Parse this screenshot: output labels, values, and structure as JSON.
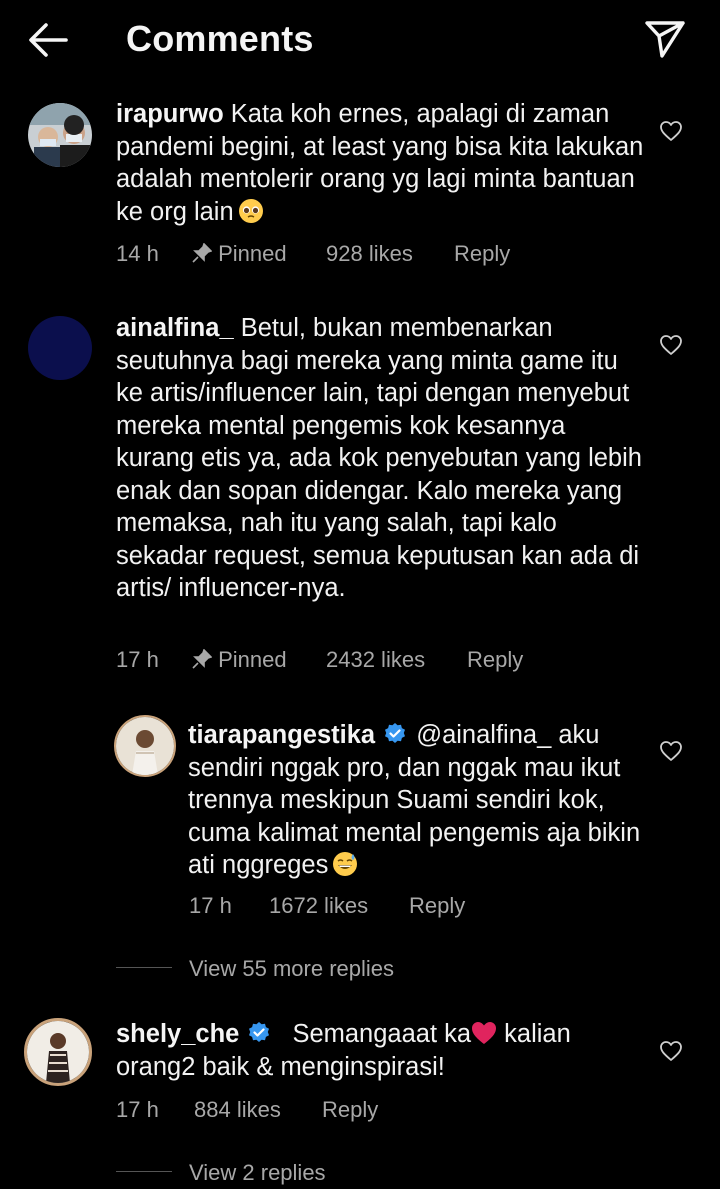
{
  "header": {
    "title": "Comments",
    "back_icon": "arrow-left-icon",
    "send_icon": "paper-plane-icon"
  },
  "comments": [
    {
      "username": "irapurwo",
      "verified": false,
      "text": "Kata koh ernes, apalagi di zaman pandemi begini, at least yang bisa kita lakukan adalah mentolerir orang yg lagi minta bantuan ke org lain",
      "emoji": "pleading-face",
      "time": "14 h",
      "pinned": "Pinned",
      "likes": "928 likes",
      "reply": "Reply"
    },
    {
      "username": "ainalfina_",
      "verified": false,
      "text": "Betul, bukan membenarkan seutuhnya bagi mereka yang minta game itu ke artis/influencer lain, tapi dengan menyebut mereka mental pengemis kok kesannya kurang etis ya, ada kok penyebutan yang lebih enak dan sopan didengar. Kalo mereka yang memaksa, nah itu yang salah, tapi kalo sekadar request, semua keputusan kan ada di artis/ influencer-nya.",
      "time": "17 h",
      "pinned": "Pinned",
      "likes": "2432 likes",
      "reply": "Reply"
    },
    {
      "username": "tiarapangestika",
      "verified": true,
      "text": "@ainalfina_ aku sendiri nggak pro, dan nggak mau ikut trennya meskipun Suami sendiri kok, cuma kalimat mental pengemis aja bikin ati nggreges",
      "emoji": "grinning-sweat-face",
      "time": "17 h",
      "likes": "1672 likes",
      "reply": "Reply",
      "is_reply": true
    },
    {
      "username": "shely_che",
      "verified": true,
      "text_before": "Semangaaat ka",
      "text_after": " kalian orang2 baik & menginspirasi!",
      "emoji": "red-heart",
      "time": "17 h",
      "likes": "884 likes",
      "reply": "Reply"
    }
  ],
  "view_replies": [
    {
      "label": "View 55 more replies"
    },
    {
      "label": "View 2 replies"
    }
  ],
  "colors": {
    "background": "#000000",
    "text": "#f2f2f2",
    "muted": "#a8a8a8",
    "verified": "#3797f0",
    "heart_emoji": "#e0245e"
  }
}
